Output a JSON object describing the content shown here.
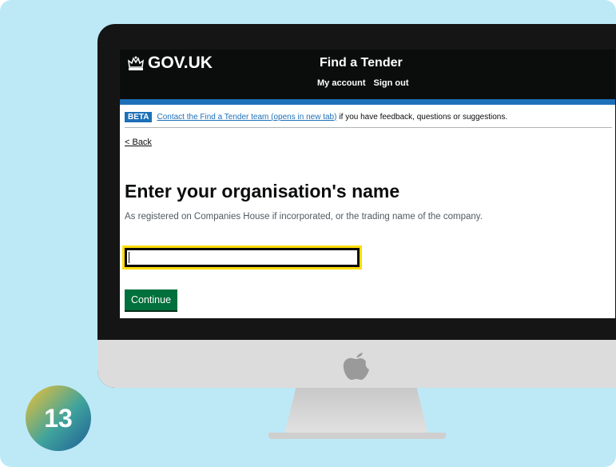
{
  "header": {
    "logo_text": "GOV.UK",
    "logo_icon": "crown-icon",
    "service_name": "Find a Tender",
    "nav": [
      "My account",
      "Sign out"
    ]
  },
  "beta_banner": {
    "tag": "BETA",
    "link_text": "Contact the Find a Tender team (opens in new tab)",
    "text": "if you have feedback, questions or suggestions."
  },
  "back_link": "< Back",
  "page": {
    "title": "Enter your organisation's name",
    "hint": "As registered on Companies House if incorporated, or the trading name of the company.",
    "input_value": "",
    "continue_label": "Continue"
  },
  "step_number": "13",
  "colors": {
    "background": "#bde9f7",
    "header": "#0b0c0c",
    "accent_blue": "#1d70b8",
    "button_green": "#00703c",
    "focus_yellow": "#ffdd00"
  }
}
